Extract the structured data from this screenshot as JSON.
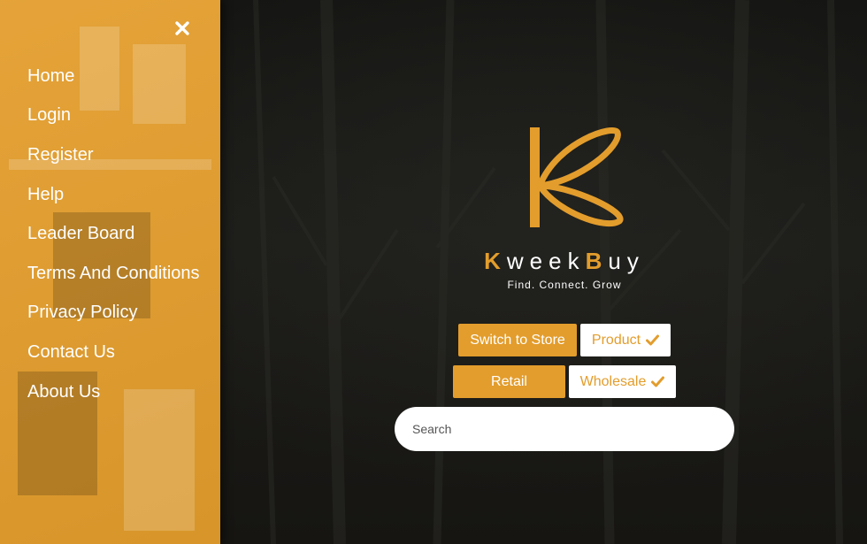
{
  "sidebar": {
    "close_icon": "close-icon",
    "items": [
      {
        "label": "Home"
      },
      {
        "label": "Login"
      },
      {
        "label": "Register"
      },
      {
        "label": "Help"
      },
      {
        "label": "Leader Board"
      },
      {
        "label": "Terms And Conditions"
      },
      {
        "label": "Privacy Policy"
      },
      {
        "label": "Contact Us"
      },
      {
        "label": "About Us"
      }
    ]
  },
  "brand": {
    "name_k": "K",
    "name_week": "week",
    "name_b": "B",
    "name_uy": "uy",
    "tagline": "Find. Connect. Grow",
    "logo_icon": "kweekbuy-logo-icon",
    "accent_color": "#e39d2c"
  },
  "buttons": {
    "switch_store": "Switch to Store",
    "product": "Product",
    "retail": "Retail",
    "wholesale": "Wholesale",
    "check_icon": "check-icon"
  },
  "search": {
    "placeholder": "Search",
    "value": ""
  }
}
